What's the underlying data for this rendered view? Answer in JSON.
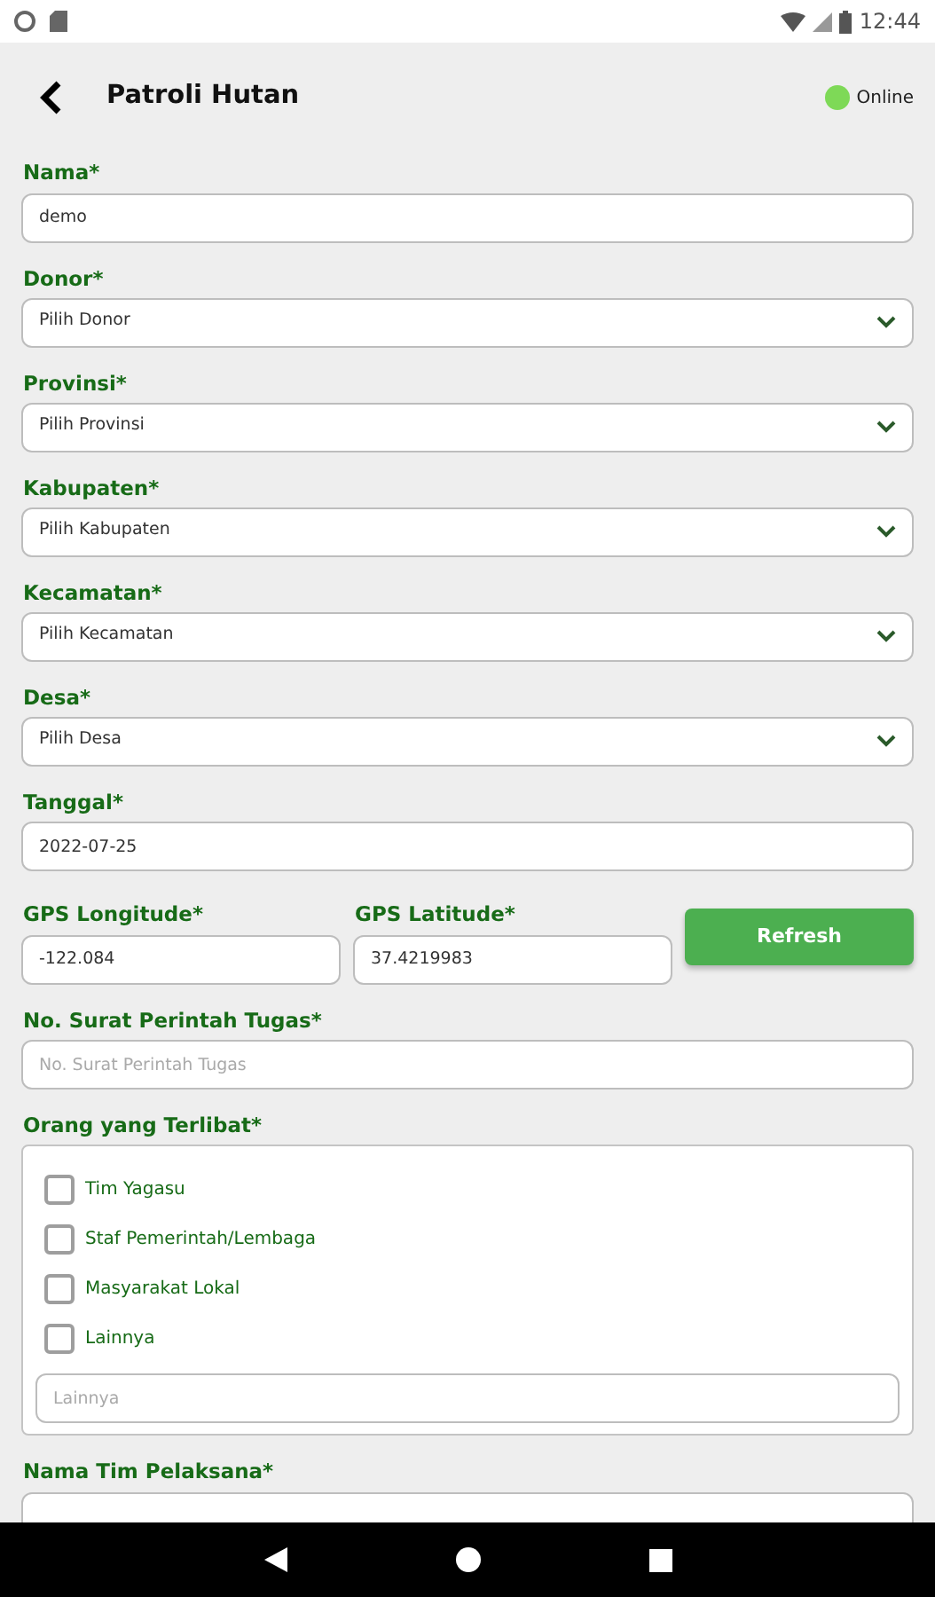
{
  "status_bar": {
    "time": "12:44"
  },
  "header": {
    "title": "Patroli Hutan",
    "status": {
      "label": "Online",
      "color": "#7ed957"
    }
  },
  "fields": [
    {
      "kind": "text",
      "label": "Nama*",
      "value": "demo"
    },
    {
      "kind": "select",
      "label": "Donor*",
      "value": "Pilih Donor"
    },
    {
      "kind": "select",
      "label": "Provinsi*",
      "value": "Pilih Provinsi"
    },
    {
      "kind": "select",
      "label": "Kabupaten*",
      "value": "Pilih Kabupaten"
    },
    {
      "kind": "select",
      "label": "Kecamatan*",
      "value": "Pilih Kecamatan"
    },
    {
      "kind": "select",
      "label": "Desa*",
      "value": "Pilih Desa"
    },
    {
      "kind": "text",
      "label": "Tanggal*",
      "value": "2022-07-25"
    },
    {
      "kind": "gps",
      "items": [
        {
          "label": "GPS Longitude*",
          "value": "-122.084"
        },
        {
          "label": "GPS Latitude*",
          "value": "37.4219983"
        }
      ],
      "button": "Refresh"
    },
    {
      "kind": "text",
      "label": "No. Surat Perintah Tugas*",
      "placeholder": "No. Surat Perintah Tugas"
    },
    {
      "kind": "checks",
      "label": "Orang yang Terlibat*",
      "options": [
        {
          "label": "Tim Yagasu",
          "checked": false
        },
        {
          "label": "Staf Pemerintah/Lembaga",
          "checked": false
        },
        {
          "label": "Masyarakat Lokal",
          "checked": false
        },
        {
          "label": "Lainnya",
          "checked": false
        }
      ],
      "other_placeholder": "Lainnya"
    },
    {
      "kind": "text",
      "label": "Nama Tim Pelaksana*"
    }
  ]
}
